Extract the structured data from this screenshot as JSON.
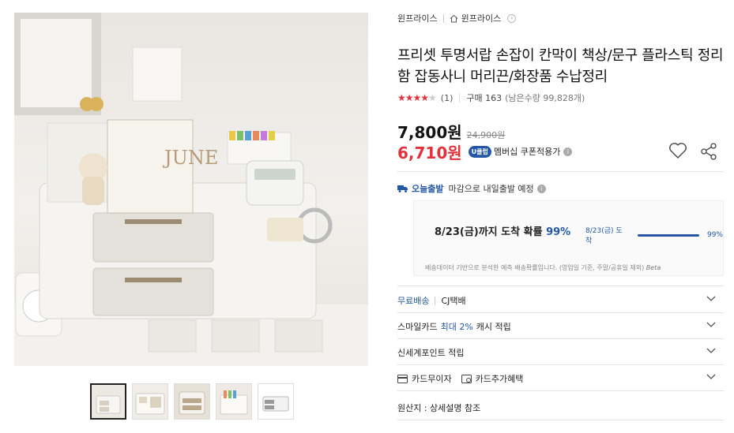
{
  "gallery": {
    "main_image_icon": "desk-organizer-photo",
    "thumbnails": [
      {
        "icon": "organizer-thumb-1",
        "active": true
      },
      {
        "icon": "organizer-thumb-2",
        "active": false
      },
      {
        "icon": "organizer-thumb-3",
        "active": false
      },
      {
        "icon": "organizer-thumb-4",
        "active": false
      },
      {
        "icon": "organizer-thumb-5",
        "active": false
      }
    ]
  },
  "breadcrumb": {
    "seller": "윈프라이스",
    "home_label": "윈프라이스"
  },
  "product": {
    "title": "프리셋 투명서랍 손잡이 칸막이 책상/문구 플라스틱 정리함 잡동사니 머리끈/화장품 수납정리",
    "rating_stars": 4,
    "review_count": "(1)",
    "purchase": "구매 163",
    "remaining": "(남은수량 99,828개)"
  },
  "price": {
    "current": "7,800원",
    "original": "24,900원",
    "sale": "6,710원",
    "club_badge": "U클럽",
    "membership": "멤버십 쿠폰적용가",
    "info_icon": "i"
  },
  "delivery": {
    "today_label": "오늘출발",
    "deadline_text": "마감으로 내일출발 예정",
    "prob_prefix": "8/23(금)까지 도착 확률",
    "prob_pct": "99%",
    "prob_mini_label": "8/23(금) 도착",
    "prob_mini_pct": "99%",
    "prob_level": 0.99,
    "note": "배송데이터 기반으로 분석한 예측 배송확률입니다. (영업일 기준, 주말/공휴일 제외)",
    "beta": "Beta"
  },
  "options": {
    "shipping_label": "무료배송",
    "shipping_carrier": "CJ택배",
    "smilecard_prefix": "스마일카드",
    "smilecard_highlight": "최대 2%",
    "smilecard_suffix": "캐시 적립",
    "shinsegae": "신세계포인트 적립",
    "card_installment": "카드무이자",
    "card_benefit": "카드추가혜택"
  },
  "origin": "원산지 : 상세설명 참조",
  "colors": {
    "accent_blue": "#2458a6",
    "sale_red": "#e3323b"
  }
}
